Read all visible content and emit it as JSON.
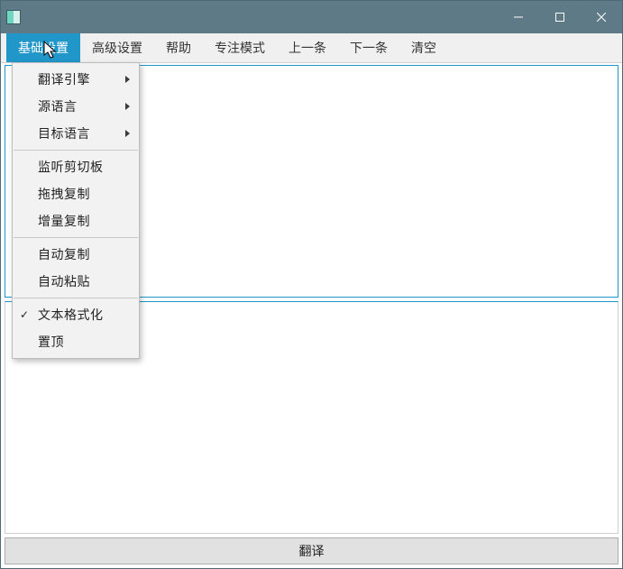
{
  "window": {
    "title": ""
  },
  "menubar": {
    "items": [
      {
        "label": "基础设置"
      },
      {
        "label": "高级设置"
      },
      {
        "label": "帮助"
      },
      {
        "label": "专注模式"
      },
      {
        "label": "上一条"
      },
      {
        "label": "下一条"
      },
      {
        "label": "清空"
      }
    ]
  },
  "dropdown": {
    "items": [
      {
        "label": "翻译引擎",
        "submenu": true
      },
      {
        "label": "源语言",
        "submenu": true
      },
      {
        "label": "目标语言",
        "submenu": true
      },
      {
        "sep": true
      },
      {
        "label": "监听剪切板"
      },
      {
        "label": "拖拽复制"
      },
      {
        "label": "增量复制"
      },
      {
        "sep": true
      },
      {
        "label": "自动复制"
      },
      {
        "label": "自动粘贴"
      },
      {
        "sep": true
      },
      {
        "label": "文本格式化",
        "checked": true
      },
      {
        "label": "置顶"
      }
    ]
  },
  "footer": {
    "translate_label": "翻译"
  },
  "colors": {
    "accent": "#2196c9",
    "titlebar": "#5f7a87"
  }
}
